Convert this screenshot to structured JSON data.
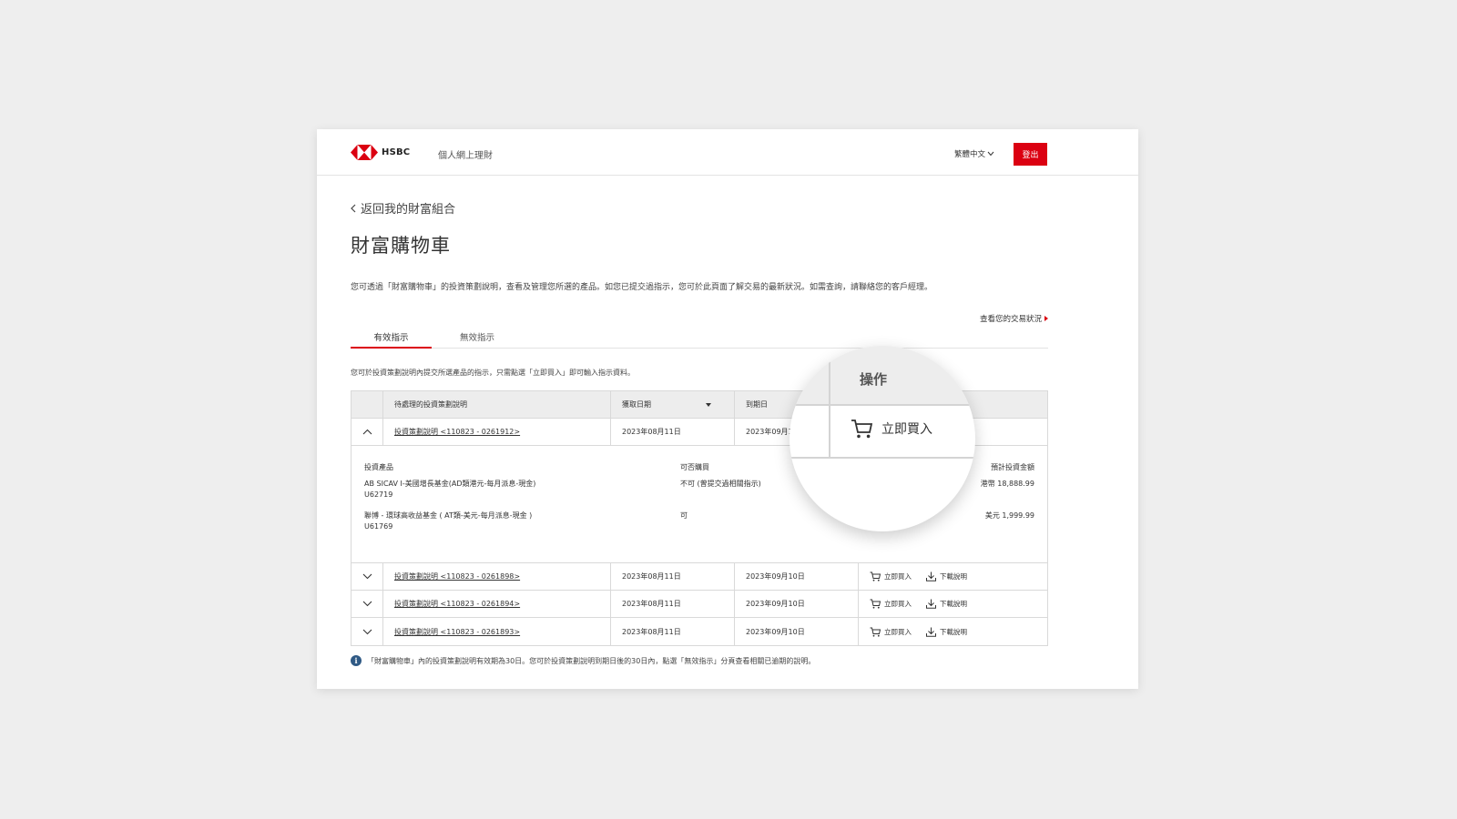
{
  "header": {
    "logo_text": "HSBC",
    "app_name": "個人網上理財",
    "language": "繁體中文",
    "logout_label": "登出",
    "brand_color": "#db0011"
  },
  "back_link": "返回我的財富組合",
  "page_title": "財富購物車",
  "intro_text": "您可透過「財富購物車」的投資策劃說明，查看及管理您所選的產品。如您已提交過指示，您可於此頁面了解交易的最新狀況。如需查詢，請聯絡您的客戶經理。",
  "status_link": "查看您的交易狀況",
  "tabs": [
    {
      "label": "有效指示",
      "active": true
    },
    {
      "label": "無效指示",
      "active": false
    }
  ],
  "hint_text": "您可於投資策劃說明內提交所選產品的指示，只需點選「立即買入」即可輸入指示資料。",
  "table": {
    "headers": {
      "name": "待處理的投資策劃說明",
      "date": "獲取日期",
      "expiry": "到期日"
    },
    "expanded_row": {
      "name": "投資策劃說明 <110823 - 0261912>",
      "date": "2023年08月11日",
      "expiry": "2023年09月1"
    },
    "detail": {
      "headers": {
        "product": "投資產品",
        "eligible": "可否購買",
        "amount": "預計投資金額"
      },
      "items": [
        {
          "name": "AB SICAV I-美國增長基金(AD類港元-每月派息-現金)",
          "code": "U62719",
          "eligible": "不可 (曾提交過相關指示)",
          "amount": "港幣 18,888.99"
        },
        {
          "name": "聯博 - 環球高收益基金 ( AT類-美元-每月派息-現金 )",
          "code": "U61769",
          "eligible": "可",
          "amount": "美元 1,999.99"
        }
      ]
    },
    "rows": [
      {
        "name": "投資策劃說明 <110823 - 0261898>",
        "date": "2023年08月11日",
        "expiry": "2023年09月10日",
        "buy": "立即買入",
        "download": "下載說明"
      },
      {
        "name": "投資策劃說明 <110823 - 0261894>",
        "date": "2023年08月11日",
        "expiry": "2023年09月10日",
        "buy": "立即買入",
        "download": "下載說明"
      },
      {
        "name": "投資策劃說明 <110823 - 0261893>",
        "date": "2023年08月11日",
        "expiry": "2023年09月10日",
        "buy": "立即買入",
        "download": "下載說明"
      }
    ]
  },
  "footnote": "「財富購物車」內的投資策劃說明有效期為30日。您可於投資策劃說明到期日後的30日內，點選「無效指示」分頁查看相關已逾期的說明。",
  "magnifier": {
    "header": "操作",
    "buy_label": "立即買入"
  }
}
